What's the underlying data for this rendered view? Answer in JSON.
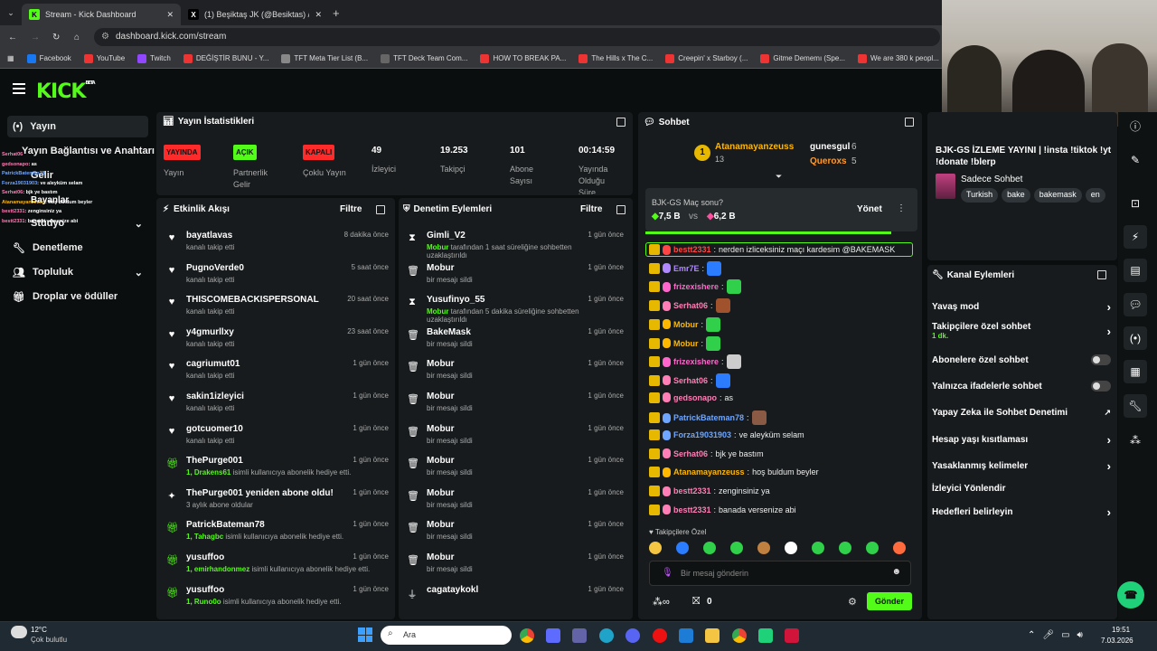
{
  "browser": {
    "tabs": [
      {
        "title": "Stream - Kick Dashboard",
        "active": true
      },
      {
        "title": "(1) Beşiktaş JK (@Besiktas) / X",
        "active": false
      }
    ],
    "url": "dashboard.kick.com/stream",
    "bookmarks": [
      "Facebook",
      "YouTube",
      "Twitch",
      "DEĞİŞTİR BUNU - Y...",
      "TFT Meta Tier List (B...",
      "TFT Deck Team Com...",
      "HOW TO BREAK PA...",
      "The Hills x The C...",
      "Creepin' x Starboy (...",
      "Gitme Dememı (Spe...",
      "We are 380 k peopl..."
    ]
  },
  "header": {
    "logo": "KICK",
    "logo_sup": "BETA"
  },
  "sidebar": {
    "items": [
      {
        "label": "Yayın"
      },
      {
        "label": "Yayın Bağlantısı ve Anahtarı"
      },
      {
        "label": "Gelir"
      },
      {
        "label": "Stüdyo"
      },
      {
        "label": "Denetleme"
      },
      {
        "label": "Topluluk"
      },
      {
        "label": "Droplar ve ödüller"
      }
    ],
    "overlay_label": "Bayanlar",
    "overlay_chat": [
      {
        "name": "Serhat06",
        "text": ""
      },
      {
        "name": "gedsonapo",
        "text": "as"
      },
      {
        "name": "PatrickBateman78",
        "text": ""
      },
      {
        "name": "Forza19031903",
        "text": "ve aleyküm selam"
      },
      {
        "name": "Serhat06",
        "text": "bjk ye bastım"
      },
      {
        "name": "Atanamayanzeuss",
        "text": "hoş buldum beyler"
      },
      {
        "name": "bestt2331",
        "text": "zenginsiniz ya"
      },
      {
        "name": "bestt2331",
        "text": "banada versenize abi"
      }
    ]
  },
  "stats": {
    "title": "Yayın İstatistikleri",
    "items": [
      {
        "badge": "YAYINDA",
        "label": "Yayın"
      },
      {
        "badge": "AÇIK",
        "label": "Partnerlik Gelir"
      },
      {
        "badge": "KAPALI",
        "label": "Çoklu Yayın"
      },
      {
        "value": "49",
        "label": "İzleyici"
      },
      {
        "value": "19.253",
        "label": "Takipçi"
      },
      {
        "value": "101",
        "label": "Abone Sayısı"
      },
      {
        "value": "00:14:59",
        "label": "Yayında Olduğu Süre"
      }
    ]
  },
  "activity": {
    "title": "Etkinlik Akışı",
    "filter": "Filtre",
    "rows": [
      {
        "icon": "heart-icon",
        "name": "bayatlavas",
        "sub": "kanalı takip etti",
        "time": "8 dakika önce"
      },
      {
        "icon": "heart-icon",
        "name": "PugnoVerde0",
        "sub": "kanalı takip etti",
        "time": "5 saat önce"
      },
      {
        "icon": "heart-icon",
        "name": "THISCOMEBACKISPERSONAL",
        "sub": "kanalı takip etti",
        "time": "20 saat önce"
      },
      {
        "icon": "heart-icon",
        "name": "y4gmurllxy",
        "sub": "kanalı takip etti",
        "time": "23 saat önce"
      },
      {
        "icon": "heart-icon",
        "name": "cagriumut01",
        "sub": "kanalı takip etti",
        "time": "1 gün önce"
      },
      {
        "icon": "heart-icon",
        "name": "sakin1izleyici",
        "sub": "kanalı takip etti",
        "time": "1 gün önce"
      },
      {
        "icon": "heart-icon",
        "name": "gotcuomer10",
        "sub": "kanalı takip etti",
        "time": "1 gün önce"
      },
      {
        "icon": "gift-icon",
        "name": "ThePurge001",
        "sub_hl": "1, Drakens61",
        "sub": " isimli kullanıcıya abonelik hediye etti.",
        "time": "1 gün önce"
      },
      {
        "icon": "star-icon",
        "name": "ThePurge001 yeniden abone oldu!",
        "sub": "3 aylık abone oldular",
        "time": "1 gün önce"
      },
      {
        "icon": "gift-icon",
        "name": "PatrickBateman78",
        "sub_hl": "1, Tahagbc",
        "sub": " isimli kullanıcıya abonelik hediye etti.",
        "time": "1 gün önce"
      },
      {
        "icon": "gift-icon",
        "name": "yusuffoo",
        "sub_hl": "1, emirhandonmez",
        "sub": " isimli kullanıcıya abonelik hediye etti.",
        "time": "1 gün önce"
      },
      {
        "icon": "gift-icon",
        "name": "yusuffoo",
        "sub_hl": "1, Runo0o",
        "sub": " isimli kullanıcıya abonelik hediye etti.",
        "time": "1 gün önce"
      }
    ]
  },
  "moderation": {
    "title": "Denetim Eylemleri",
    "filter": "Filtre",
    "rows": [
      {
        "icon": "hourglass-icon",
        "name": "Gimli_V2",
        "sub_hl": "Mobur",
        "sub": " tarafından 1 saat süreliğine sohbetten uzaklaştırıldı",
        "time": "1 gün önce"
      },
      {
        "icon": "trash-icon",
        "name": "Mobur",
        "sub": "bir mesajı sildi",
        "time": "1 gün önce"
      },
      {
        "icon": "hourglass-icon",
        "name": "Yusufinyo_55",
        "sub_hl": "Mobur",
        "sub": " tarafından 5 dakika süreliğine sohbetten uzaklaştırıldı",
        "time": "1 gün önce"
      },
      {
        "icon": "trash-icon",
        "name": "BakeMask",
        "sub": "bir mesajı sildi",
        "time": "1 gün önce"
      },
      {
        "icon": "trash-icon",
        "name": "Mobur",
        "sub": "bir mesajı sildi",
        "time": "1 gün önce"
      },
      {
        "icon": "trash-icon",
        "name": "Mobur",
        "sub": "bir mesajı sildi",
        "time": "1 gün önce"
      },
      {
        "icon": "trash-icon",
        "name": "Mobur",
        "sub": "bir mesajı sildi",
        "time": "1 gün önce"
      },
      {
        "icon": "trash-icon",
        "name": "Mobur",
        "sub": "bir mesajı sildi",
        "time": "1 gün önce"
      },
      {
        "icon": "trash-icon",
        "name": "Mobur",
        "sub": "bir mesajı sildi",
        "time": "1 gün önce"
      },
      {
        "icon": "trash-icon",
        "name": "Mobur",
        "sub": "bir mesajı sildi",
        "time": "1 gün önce"
      },
      {
        "icon": "trash-icon",
        "name": "Mobur",
        "sub": "bir mesajı sildi",
        "time": "1 gün önce"
      },
      {
        "icon": "filter-icon",
        "name": "cagataykokl",
        "sub": "",
        "time": "1 gün önce"
      }
    ]
  },
  "chat": {
    "title": "Sohbet",
    "top_gifters": [
      {
        "rank": "1",
        "name": "Atanamayanzeuss",
        "count": "13"
      },
      {
        "name": "gunesgul",
        "count": "6"
      },
      {
        "name": "Queroxs",
        "count": "5"
      }
    ],
    "prediction": {
      "question": "BJK-GS Maç sonu?",
      "a": "7,5 B",
      "vs": "vs",
      "b": "6,2 B",
      "manage": "Yönet"
    },
    "messages": [
      {
        "name": "bestt2331",
        "color": "#ff4545",
        "text": "nerden izliceksiniz maçı kardesim @BAKEMASK",
        "highlight": true
      },
      {
        "name": "Emr7E",
        "color": "#b088ff",
        "text": ""
      },
      {
        "name": "frizexishere",
        "color": "#ff66cc",
        "text": ""
      },
      {
        "name": "Serhat06",
        "color": "#ff7eb6",
        "text": ""
      },
      {
        "name": "Mobur",
        "color": "#ffb700",
        "text": ""
      },
      {
        "name": "Mobur",
        "color": "#ffb700",
        "text": ""
      },
      {
        "name": "frizexishere",
        "color": "#ff66cc",
        "text": ""
      },
      {
        "name": "Serhat06",
        "color": "#ff7eb6",
        "text": ""
      },
      {
        "name": "gedsonapo",
        "color": "#ff7eb6",
        "text": "as"
      },
      {
        "name": "PatrickBateman78",
        "color": "#6fa6ff",
        "text": ""
      },
      {
        "name": "Forza19031903",
        "color": "#6fa6ff",
        "text": "ve aleyküm selam"
      },
      {
        "name": "Serhat06",
        "color": "#ff7eb6",
        "text": "bjk ye bastım"
      },
      {
        "name": "Atanamayanzeuss",
        "color": "#ffb700",
        "text": "hoş buldum beyler"
      },
      {
        "name": "bestt2331",
        "color": "#ff7eb6",
        "text": "zenginsiniz ya"
      },
      {
        "name": "bestt2331",
        "color": "#ff7eb6",
        "text": "banada versenize abi"
      }
    ],
    "followers_only": "Takipçilere Özel",
    "input_placeholder": "Bir mesaj gönderin",
    "points": "0",
    "send": "Gönder"
  },
  "stream_info": {
    "title": "BJK-GS İZLEME YAYINI | !insta !tiktok !yt !donate !blerp",
    "category": "Sadece Sohbet",
    "tags": [
      "Turkish",
      "bake",
      "bakemask",
      "en"
    ]
  },
  "channel_actions": {
    "title": "Kanal Eylemleri",
    "rows": [
      {
        "label": "Yavaş mod",
        "type": "chevron"
      },
      {
        "label": "Takipçilere özel sohbet",
        "sub": "1 dk.",
        "type": "chevron"
      },
      {
        "label": "Abonelere özel sohbet",
        "type": "toggle"
      },
      {
        "label": "Yalnızca ifadelerle sohbet",
        "type": "toggle"
      },
      {
        "label": "Yapay Zeka ile Sohbet Denetimi",
        "type": "external"
      },
      {
        "label": "Hesap yaşı kısıtlaması",
        "type": "chevron"
      },
      {
        "label": "Yasaklanmış kelimeler",
        "type": "chevron"
      },
      {
        "label": "İzleyici Yönlendir",
        "type": "none"
      },
      {
        "label": "Hedefleri belirleyin",
        "type": "chevron"
      }
    ]
  },
  "taskbar": {
    "weather_temp": "12°C",
    "weather_desc": "Çok bulutlu",
    "search": "Ara",
    "time": "19:51",
    "date": "7.03.2026"
  },
  "colors": {
    "accent": "#53fc18",
    "panel": "#171b1d",
    "bg": "#0b0e0f"
  }
}
